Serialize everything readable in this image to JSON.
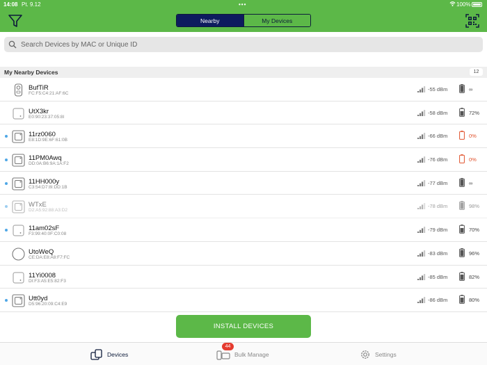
{
  "status_bar": {
    "time": "14:08",
    "date": "Pt. 9.12",
    "battery": "100%"
  },
  "header": {
    "tabs": [
      {
        "label": "Nearby",
        "active": true
      },
      {
        "label": "My Devices",
        "active": false
      }
    ],
    "colors": {
      "brand": "#5cb848",
      "tab_active": "#0d1b5e"
    }
  },
  "search": {
    "placeholder": "Search Devices by MAC or Unique ID"
  },
  "section": {
    "title": "My Nearby Devices",
    "count": "12"
  },
  "devices": [
    {
      "name": "BufTiR",
      "mac": "FC:F5:C4:21:AF:6C",
      "signal": "-55 dBm",
      "battery": "∞",
      "icon": "cylinder-device-icon",
      "dot": false,
      "dim": false,
      "low": false,
      "level": 1.0
    },
    {
      "name": "UtX3kr",
      "mac": "E0:90:23:37:05:8I",
      "signal": "-58 dBm",
      "battery": "72%",
      "icon": "square-device-icon",
      "dot": false,
      "dim": false,
      "low": false,
      "level": 0.72
    },
    {
      "name": "11rz0060",
      "mac": "E8:1D:9E:6F:61:0B",
      "signal": "-66 dBm",
      "battery": "0%",
      "icon": "boxed-device-icon",
      "dot": true,
      "dim": false,
      "low": true,
      "level": 0.0
    },
    {
      "name": "11PM0Awq",
      "mac": "DD:0A:B6:9A:1A:F2",
      "signal": "-76 dBm",
      "battery": "0%",
      "icon": "boxed-device-icon",
      "dot": true,
      "dim": false,
      "low": true,
      "level": 0.0
    },
    {
      "name": "11HH000y",
      "mac": "C3:54:D7:8I:DD:1B",
      "signal": "-77 dBm",
      "battery": "∞",
      "icon": "boxed-device-icon",
      "dot": true,
      "dim": false,
      "low": false,
      "level": 1.0
    },
    {
      "name": "WTxE",
      "mac": "D2:A5:92:88:A3:D2",
      "signal": "-78 dBm",
      "battery": "98%",
      "icon": "boxed-device-icon",
      "dot": true,
      "dim": true,
      "low": false,
      "level": 0.98
    },
    {
      "name": "11am02sF",
      "mac": "F3:99:40:0F:C0:08",
      "signal": "-79 dBm",
      "battery": "70%",
      "icon": "square-device-icon",
      "dot": true,
      "dim": false,
      "low": false,
      "level": 0.7
    },
    {
      "name": "UtoWeQ",
      "mac": "CE:DA:E8:A8:F7:FC",
      "signal": "-83 dBm",
      "battery": "96%",
      "icon": "round-device-icon",
      "dot": false,
      "dim": false,
      "low": false,
      "level": 0.96
    },
    {
      "name": "11Yi0008",
      "mac": "DI:F3:A5:E5:82:F3",
      "signal": "-85 dBm",
      "battery": "82%",
      "icon": "square-device-icon",
      "dot": false,
      "dim": false,
      "low": false,
      "level": 0.82
    },
    {
      "name": "Utt0yd",
      "mac": "D5:96:20:09:C4:E9",
      "signal": "-86 dBm",
      "battery": "80%",
      "icon": "boxed-device-icon",
      "dot": true,
      "dim": false,
      "low": false,
      "level": 0.8
    }
  ],
  "install": {
    "label": "INSTALL DEVICES"
  },
  "tabbar": {
    "items": [
      {
        "label": "Devices",
        "icon": "devices-icon"
      },
      {
        "label": "Bulk Manage",
        "icon": "bulk-manage-icon",
        "badge": "44"
      },
      {
        "label": "Settings",
        "icon": "gear-icon"
      }
    ]
  }
}
